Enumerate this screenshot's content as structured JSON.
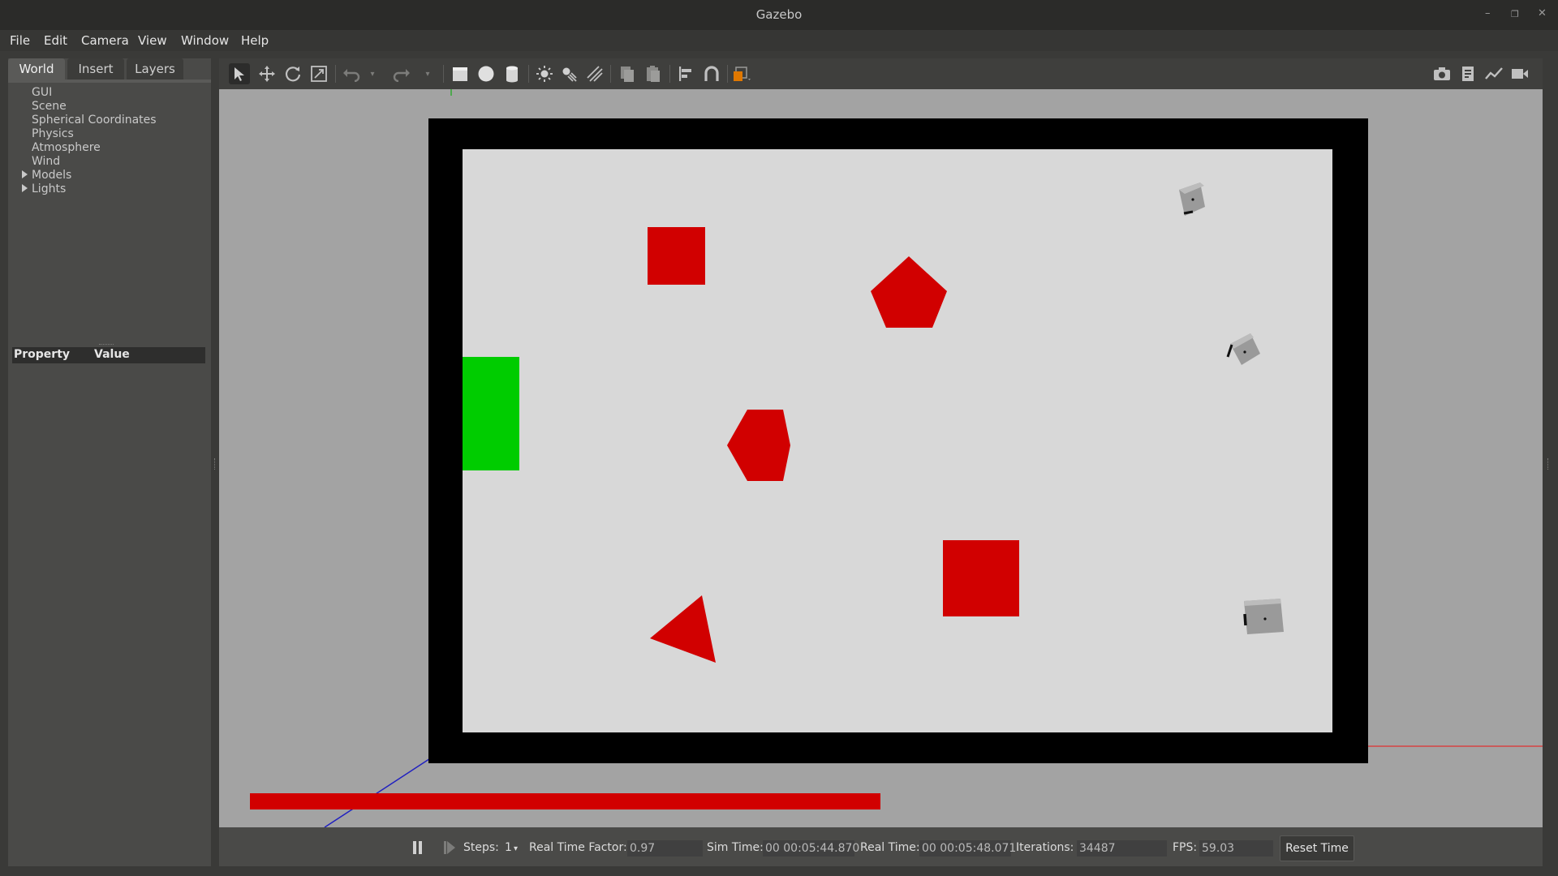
{
  "window": {
    "title": "Gazebo"
  },
  "menu": [
    "File",
    "Edit",
    "Camera",
    "View",
    "Window",
    "Help"
  ],
  "left_panel": {
    "tabs": [
      "World",
      "Insert",
      "Layers"
    ],
    "active_tab": "World",
    "tree": [
      {
        "label": "GUI",
        "expandable": false
      },
      {
        "label": "Scene",
        "expandable": false
      },
      {
        "label": "Spherical Coordinates",
        "expandable": false
      },
      {
        "label": "Physics",
        "expandable": false
      },
      {
        "label": "Atmosphere",
        "expandable": false
      },
      {
        "label": "Wind",
        "expandable": false
      },
      {
        "label": "Models",
        "expandable": true
      },
      {
        "label": "Lights",
        "expandable": true
      }
    ],
    "property_header": {
      "property": "Property",
      "value": "Value"
    }
  },
  "toolbar": {
    "tools": [
      "select-icon",
      "translate-icon",
      "rotate-icon",
      "scale-icon",
      "undo-icon",
      "redo-icon",
      "box-icon",
      "sphere-icon",
      "cylinder-icon",
      "point-light-icon",
      "spot-light-icon",
      "directional-light-icon",
      "copy-icon",
      "paste-icon",
      "align-icon",
      "snap-icon",
      "view-angle-icon"
    ],
    "right_tools": [
      "screenshot-icon",
      "log-icon",
      "plot-icon",
      "record-icon"
    ]
  },
  "scene": {
    "wall_color": "#000000",
    "floor_color": "#d8d8d8",
    "ground_color": "#a3a3a3",
    "shape_color": "#d10000",
    "goal_color": "#00cc00",
    "objects": [
      "red-square-1",
      "red-pentagon",
      "green-goal",
      "red-hexagon",
      "red-square-2",
      "red-triangle",
      "robot-1",
      "robot-2",
      "robot-3"
    ]
  },
  "bottom_bar": {
    "steps_label": "Steps:",
    "steps_value": "1",
    "rtf_label": "Real Time Factor:",
    "rtf_value": "0.97",
    "sim_time_label": "Sim Time:",
    "sim_time_value": "00 00:05:44.870",
    "real_time_label": "Real Time:",
    "real_time_value": "00 00:05:48.071",
    "iterations_label": "Iterations:",
    "iterations_value": "34487",
    "fps_label": "FPS:",
    "fps_value": "59.03",
    "reset_label": "Reset Time"
  }
}
